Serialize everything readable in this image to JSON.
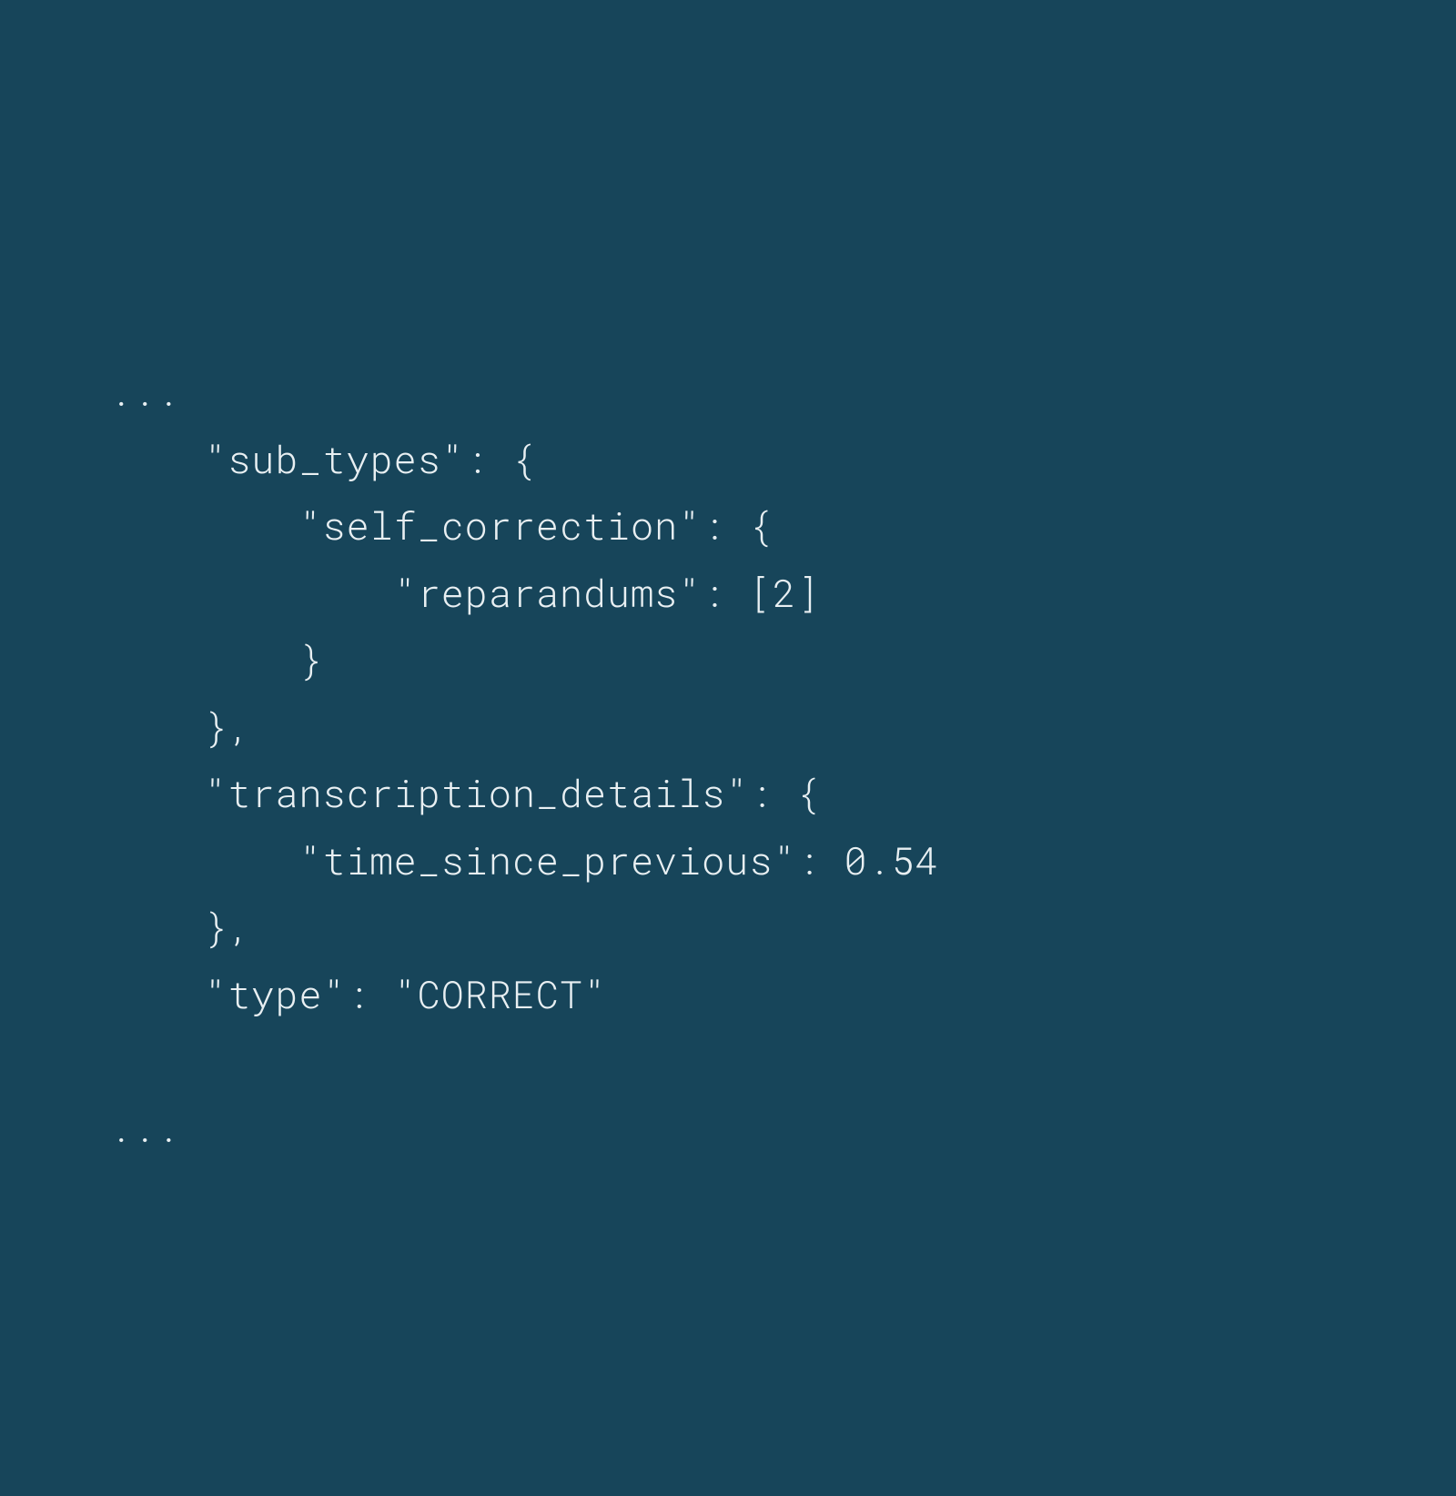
{
  "code": {
    "ellipsis_top": "...",
    "line1": "    \"sub_types\": {",
    "line2": "        \"self_correction\": {",
    "line3": "            \"reparandums\": [2]",
    "line4": "        }",
    "line5": "    },",
    "line6": "    \"transcription_details\": {",
    "line7": "        \"time_since_previous\": 0.54",
    "line8": "    },",
    "line9": "    \"type\": \"CORRECT\"",
    "ellipsis_bottom": "..."
  },
  "json_content": {
    "sub_types": {
      "self_correction": {
        "reparandums": [
          2
        ]
      }
    },
    "transcription_details": {
      "time_since_previous": 0.54
    },
    "type": "CORRECT"
  }
}
